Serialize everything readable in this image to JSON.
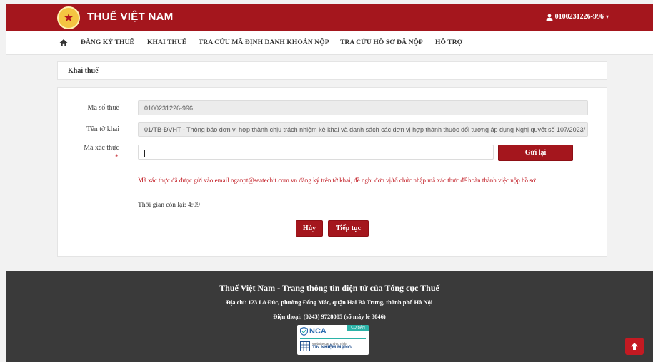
{
  "header": {
    "brand": "THUẾ VIỆT NAM",
    "user_label": "0100231226-996",
    "colors": {
      "primary": "#a4161d",
      "footer": "#3a3a3a"
    }
  },
  "nav": {
    "home_icon": "home-icon",
    "items": [
      "ĐĂNG KÝ THUẾ",
      "KHAI THUẾ",
      "TRA CỨU MÃ ĐỊNH DANH KHOẢN NỘP",
      "TRA CỨU HỒ SƠ ĐÃ NỘP",
      "HỖ TRỢ"
    ]
  },
  "breadcrumb": {
    "title": "Khai thuế"
  },
  "form": {
    "tax_code_label": "Mã số thuế",
    "tax_code_value": "0100231226-996",
    "form_name_label": "Tên tờ khai",
    "form_name_value": "01/TB-ĐVHT - Thông báo đơn vị hợp thành chịu trách nhiệm kê khai và danh sách các đơn vị hợp thành thuộc đối tượng áp dụng Nghị quyết số 107/2023/",
    "otp_label": "Mã xác thực",
    "required_mark": "*",
    "otp_value": "",
    "resend_label": "Gửi lại",
    "message": "Mã xác thực đã được gửi vào email nganpt@seatechit.com.vn đăng ký trên tờ khai, đề nghị đơn vị/tổ chức nhập mã xác thực để hoàn thành việc nộp hồ sơ",
    "timer_text": "Thời gian còn lại: 4:09",
    "cancel_label": "Hủy",
    "continue_label": "Tiếp tục"
  },
  "footer": {
    "title": "Thuế Việt Nam - Trang thông tin điện tử của Tổng cục Thuế",
    "address": "Địa chỉ: 123 Lò Đúc, phường Đống Mác, quận Hai Bà Trưng, thành phố Hà Nội",
    "phone": "Điện thoại: (0243) 9728085 (số máy lẻ 3046)",
    "badge": {
      "brand": "NCA",
      "tag": "CƠ BẢN",
      "small_text": "Website đạt chứng nhận",
      "big_text": "TÍN NHIỆM MẠNG"
    }
  },
  "scroll_top_icon": "arrow-up-icon"
}
